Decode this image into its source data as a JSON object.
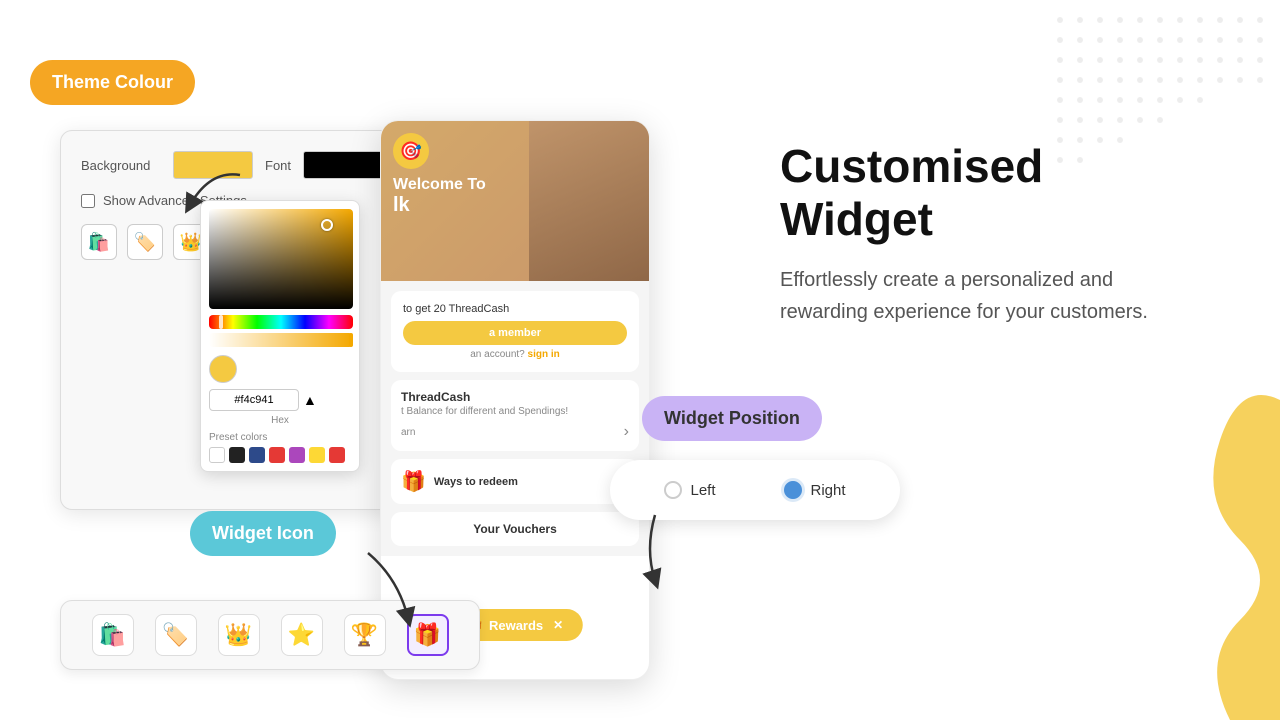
{
  "theme_colour_label": "Theme Colour",
  "widget_icon_label": "Widget Icon",
  "widget_position_label": "Widget Position",
  "main_title": "Customised Widget",
  "sub_text": "Effortlessly create a personalized and rewarding experience for your customers.",
  "settings": {
    "background_label": "Background",
    "font_label": "Font",
    "font_hex": "#000",
    "show_advanced": "Show Advanced Settings",
    "hex_value": "#f4c941",
    "hex_label": "Hex",
    "preset_label": "Preset colors"
  },
  "mobile": {
    "welcome": "Welcome To",
    "rewards_btn": "Rewards",
    "signup_text": "to get 20 ThreadCash",
    "signup_btn": "a member",
    "signin_text": "an account?",
    "signin_link": "sign in",
    "tc_title": "ThreadCash",
    "tc_desc": "t Balance for different and Spendings!",
    "learn_text": "arn",
    "redeem_text": "Ways to redeem",
    "vouchers_title": "Your Vouchers"
  },
  "position": {
    "left_label": "Left",
    "right_label": "Right"
  },
  "icons": {
    "list": [
      "🛍️",
      "🏷️",
      "👑",
      "⭐",
      "🏆",
      "🎁"
    ]
  },
  "preset_colors": [
    "#fff",
    "#000",
    "#2d4a8a",
    "#e53935",
    "#ab47bc",
    "#fdd835",
    "#e53935"
  ]
}
